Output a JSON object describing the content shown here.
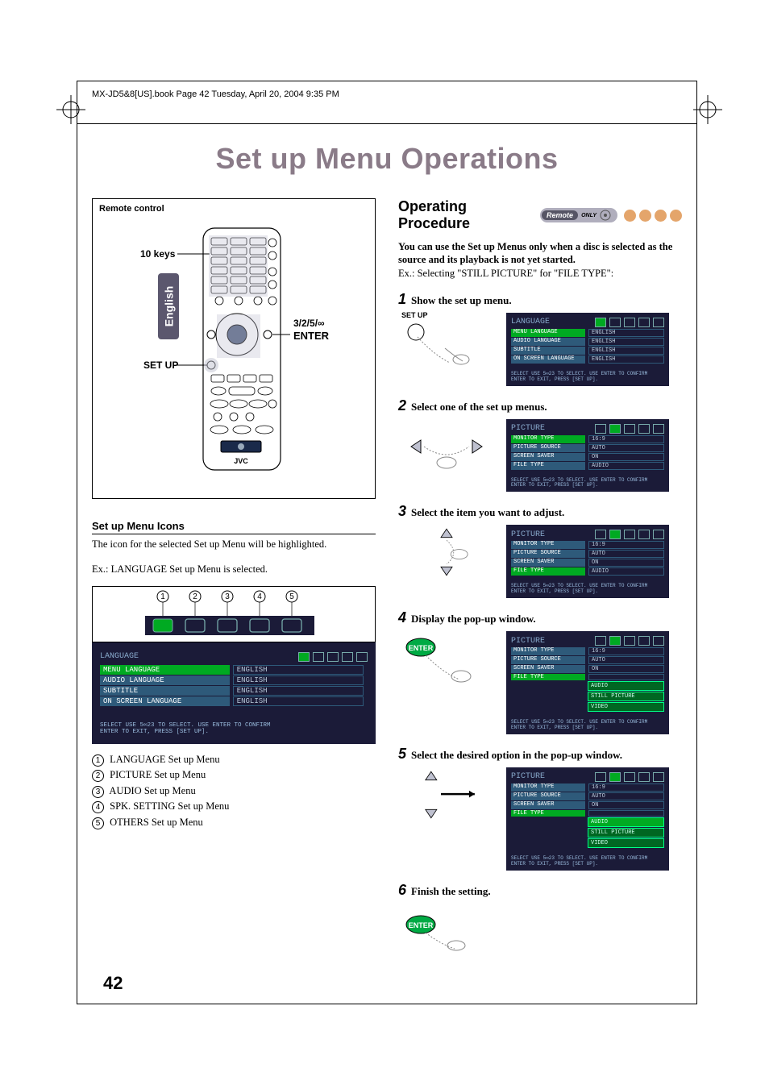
{
  "header": "MX-JD5&8[US].book  Page 42  Tuesday, April 20, 2004  9:35 PM",
  "language_tab": "English",
  "title": "Set up Menu Operations",
  "remote": {
    "caption": "Remote control",
    "label_10keys": "10 keys",
    "label_setup": "SET UP",
    "label_arrows": "3/2/5/∞",
    "label_enter": "ENTER",
    "brand": "JVC"
  },
  "icons_section": {
    "heading": "Set up Menu Icons",
    "text": "The icon for the selected Set up Menu will be highlighted.",
    "example": "Ex.: LANGUAGE Set up Menu is selected.",
    "numbers": [
      "1",
      "2",
      "3",
      "4",
      "5"
    ]
  },
  "menu_language": {
    "title": "LANGUAGE",
    "rows": [
      {
        "lbl": "MENU LANGUAGE",
        "val": "ENGLISH",
        "sel": true
      },
      {
        "lbl": "AUDIO LANGUAGE",
        "val": "ENGLISH"
      },
      {
        "lbl": "SUBTITLE",
        "val": "ENGLISH"
      },
      {
        "lbl": "ON SCREEN LANGUAGE",
        "val": "ENGLISH"
      }
    ],
    "hint1": "SELECT      USE 5∞23 TO SELECT. USE ENTER TO CONFIRM",
    "hint2": "ENTER       TO EXIT, PRESS [SET UP]."
  },
  "legend": [
    "LANGUAGE Set up Menu",
    "PICTURE Set up Menu",
    "AUDIO Set up Menu",
    "SPK. SETTING Set up Menu",
    "OTHERS Set up Menu"
  ],
  "right": {
    "heading": "Operating Procedure",
    "badge": "Remote",
    "badge_only": "ONLY",
    "intro_bold": "You can use the Set up Menus only when a disc is selected as the source and its playback is not yet started.",
    "intro_ex": "Ex.: Selecting \"STILL PICTURE\" for \"FILE TYPE\":",
    "steps": [
      {
        "n": "1",
        "t": "Show the set up menu.",
        "setup_label": "SET UP"
      },
      {
        "n": "2",
        "t": "Select one of the set up menus."
      },
      {
        "n": "3",
        "t": "Select the item you want to adjust."
      },
      {
        "n": "4",
        "t": "Display the pop-up window."
      },
      {
        "n": "5",
        "t": "Select the desired option in the pop-up window."
      },
      {
        "n": "6",
        "t": "Finish the setting."
      }
    ]
  },
  "menu_picture": {
    "title": "PICTURE",
    "rows": [
      {
        "lbl": "MONITOR TYPE",
        "val": "16:9"
      },
      {
        "lbl": "PICTURE SOURCE",
        "val": "AUTO"
      },
      {
        "lbl": "SCREEN SAVER",
        "val": "ON"
      },
      {
        "lbl": "FILE TYPE",
        "val": "AUDIO"
      }
    ],
    "hint1": "SELECT      USE 5∞23 TO SELECT. USE ENTER TO CONFIRM",
    "hint2": "ENTER       TO EXIT, PRESS [SET UP]."
  },
  "menu_picture_sel_monitor": {
    "title": "PICTURE",
    "rows": [
      {
        "lbl": "MONITOR TYPE",
        "val": "16:9",
        "sel": true
      },
      {
        "lbl": "PICTURE SOURCE",
        "val": "AUTO"
      },
      {
        "lbl": "SCREEN SAVER",
        "val": "ON"
      },
      {
        "lbl": "FILE TYPE",
        "val": "AUDIO"
      }
    ]
  },
  "menu_picture_popup": {
    "title": "PICTURE",
    "rows": [
      {
        "lbl": "MONITOR TYPE",
        "val": "16:9"
      },
      {
        "lbl": "PICTURE SOURCE",
        "val": "AUTO"
      },
      {
        "lbl": "SCREEN SAVER",
        "val": "ON"
      },
      {
        "lbl": "FILE TYPE",
        "val": "",
        "sel": true
      }
    ],
    "popup": [
      "AUDIO",
      "STILL PICTURE",
      "VIDEO"
    ]
  },
  "menu_picture_popup_sel": {
    "title": "PICTURE",
    "rows": [
      {
        "lbl": "MONITOR TYPE",
        "val": "16:9"
      },
      {
        "lbl": "PICTURE SOURCE",
        "val": "AUTO"
      },
      {
        "lbl": "SCREEN SAVER",
        "val": "ON"
      },
      {
        "lbl": "FILE TYPE",
        "val": "",
        "sel": true
      }
    ],
    "popup": [
      "AUDIO",
      "STILL PICTURE",
      "VIDEO"
    ],
    "popup_sel": 0
  },
  "enter_label": "ENTER",
  "page_number": "42"
}
